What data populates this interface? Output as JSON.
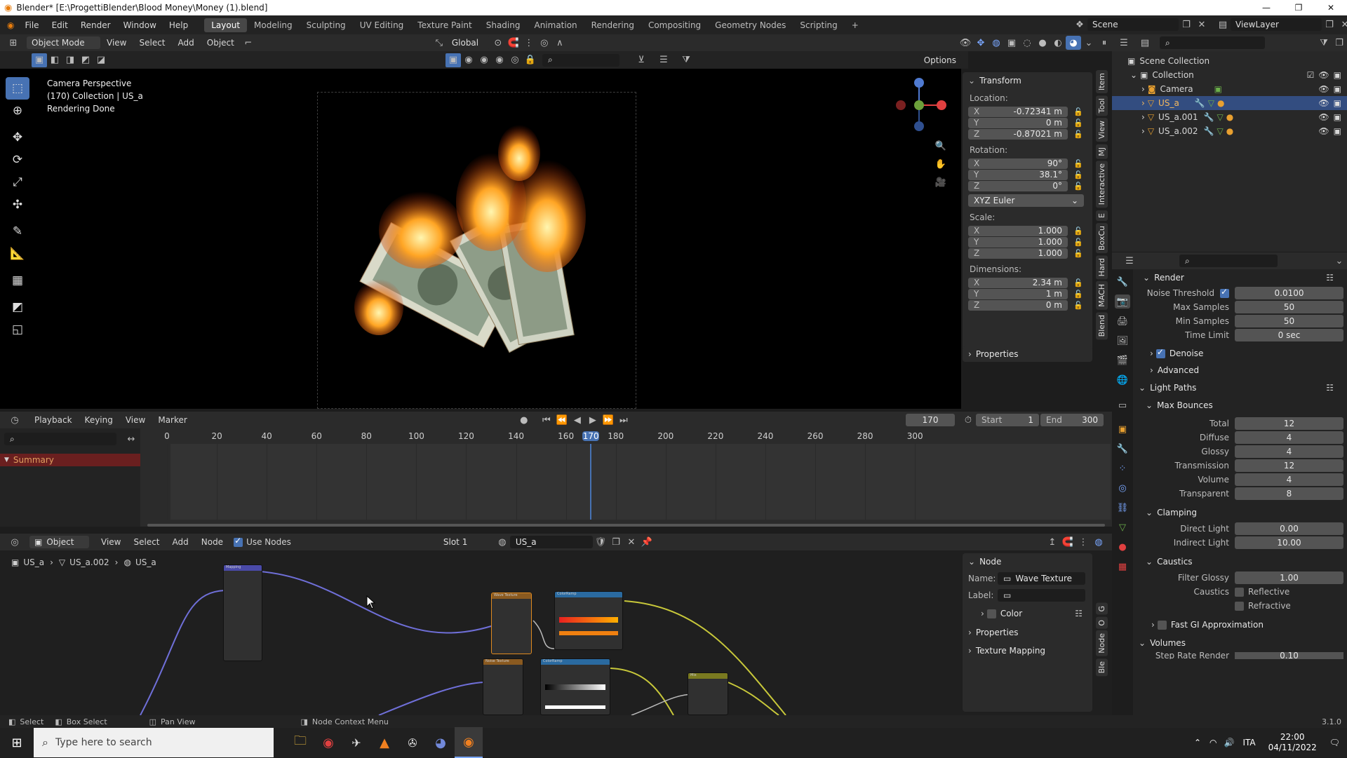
{
  "titlebar": {
    "title": "Blender* [E:\\ProgettiBlender\\Blood Money\\Money (1).blend]",
    "minimize": "—",
    "maximize": "❐",
    "close": "✕"
  },
  "menu": {
    "items": [
      "File",
      "Edit",
      "Render",
      "Window",
      "Help"
    ]
  },
  "workspaces": [
    "Layout",
    "Modeling",
    "Sculpting",
    "UV Editing",
    "Texture Paint",
    "Shading",
    "Animation",
    "Rendering",
    "Compositing",
    "Geometry Nodes",
    "Scripting"
  ],
  "add_workspace": "+",
  "scene": {
    "name": "Scene",
    "view_layer": "ViewLayer"
  },
  "viewport_header": {
    "mode": "Object Mode",
    "menus": [
      "View",
      "Select",
      "Add",
      "Object"
    ],
    "orientation": "Global",
    "options": "Options"
  },
  "viewport": {
    "line1": "Camera Perspective",
    "line2": "(170) Collection | US_a",
    "line3": "Rendering Done"
  },
  "transform": {
    "title": "Transform",
    "location_label": "Location:",
    "location": [
      {
        "axis": "X",
        "value": "-0.72341 m"
      },
      {
        "axis": "Y",
        "value": "0 m"
      },
      {
        "axis": "Z",
        "value": "-0.87021 m"
      }
    ],
    "rotation_label": "Rotation:",
    "rotation": [
      {
        "axis": "X",
        "value": "90°"
      },
      {
        "axis": "Y",
        "value": "38.1°"
      },
      {
        "axis": "Z",
        "value": "0°"
      }
    ],
    "rotation_mode": "XYZ Euler",
    "scale_label": "Scale:",
    "scale": [
      {
        "axis": "X",
        "value": "1.000"
      },
      {
        "axis": "Y",
        "value": "1.000"
      },
      {
        "axis": "Z",
        "value": "1.000"
      }
    ],
    "dimensions_label": "Dimensions:",
    "dimensions": [
      {
        "axis": "X",
        "value": "2.34 m"
      },
      {
        "axis": "Y",
        "value": "1 m"
      },
      {
        "axis": "Z",
        "value": "0 m"
      }
    ],
    "properties": "Properties"
  },
  "side_tabs": [
    "Item",
    "Tool",
    "View",
    "MJ",
    "Interactive",
    "E",
    "BoxCu",
    "Hard",
    "MACH",
    "Blend"
  ],
  "outliner": {
    "root": "Scene Collection",
    "collection": "Collection",
    "objects": [
      "Camera",
      "US_a",
      "US_a.001",
      "US_a.002"
    ]
  },
  "properties": {
    "render": "Render",
    "noise_threshold": {
      "label": "Noise Threshold",
      "value": "0.0100"
    },
    "max_samples": {
      "label": "Max Samples",
      "value": "50"
    },
    "min_samples": {
      "label": "Min Samples",
      "value": "50"
    },
    "time_limit": {
      "label": "Time Limit",
      "value": "0 sec"
    },
    "denoise": "Denoise",
    "advanced": "Advanced",
    "light_paths": "Light Paths",
    "max_bounces": "Max Bounces",
    "bounces": [
      {
        "label": "Total",
        "value": "12"
      },
      {
        "label": "Diffuse",
        "value": "4"
      },
      {
        "label": "Glossy",
        "value": "4"
      },
      {
        "label": "Transmission",
        "value": "12"
      },
      {
        "label": "Volume",
        "value": "4"
      },
      {
        "label": "Transparent",
        "value": "8"
      }
    ],
    "clamping": "Clamping",
    "direct_light": {
      "label": "Direct Light",
      "value": "0.00"
    },
    "indirect_light": {
      "label": "Indirect Light",
      "value": "10.00"
    },
    "caustics": "Caustics",
    "filter_glossy": {
      "label": "Filter Glossy",
      "value": "1.00"
    },
    "caustics_label": "Caustics",
    "reflective": "Reflective",
    "refractive": "Refractive",
    "fast_gi": "Fast GI Approximation",
    "volumes": "Volumes",
    "step_rate": "Step Rate Render",
    "step_rate_value": "0.10"
  },
  "timeline": {
    "menus": [
      "Playback",
      "Keying",
      "View",
      "Marker"
    ],
    "current_frame": "170",
    "start_label": "Start",
    "start": "1",
    "end_label": "End",
    "end": "300",
    "ticks": [
      "0",
      "20",
      "40",
      "60",
      "80",
      "100",
      "120",
      "140",
      "160",
      "170",
      "180",
      "200",
      "220",
      "240",
      "260",
      "280",
      "300"
    ],
    "summary": "Summary"
  },
  "node_editor": {
    "mode": "Object",
    "menus": [
      "View",
      "Select",
      "Add",
      "Node"
    ],
    "use_nodes": "Use Nodes",
    "slot": "Slot 1",
    "material": "US_a",
    "breadcrumb": [
      "US_a",
      "US_a.002",
      "US_a"
    ]
  },
  "node_panel": {
    "title": "Node",
    "name_label": "Name:",
    "name": "Wave Texture",
    "label_label": "Label:",
    "label": "",
    "color": "Color",
    "properties": "Properties",
    "texture_mapping": "Texture Mapping"
  },
  "nodes": {
    "mapping": "Mapping",
    "wave": "Wave Texture",
    "ramp": "ColorRamp",
    "noise": "Noise Texture",
    "ramp2": "ColorRamp",
    "mix": "Mix"
  },
  "statusbar": {
    "select": "Select",
    "box_select": "Box Select",
    "pan_view": "Pan View",
    "context_menu": "Node Context Menu",
    "version": "3.1.0"
  },
  "taskbar": {
    "search_placeholder": "Type here to search",
    "lang": "ITA",
    "time": "22:00",
    "date": "04/11/2022"
  }
}
